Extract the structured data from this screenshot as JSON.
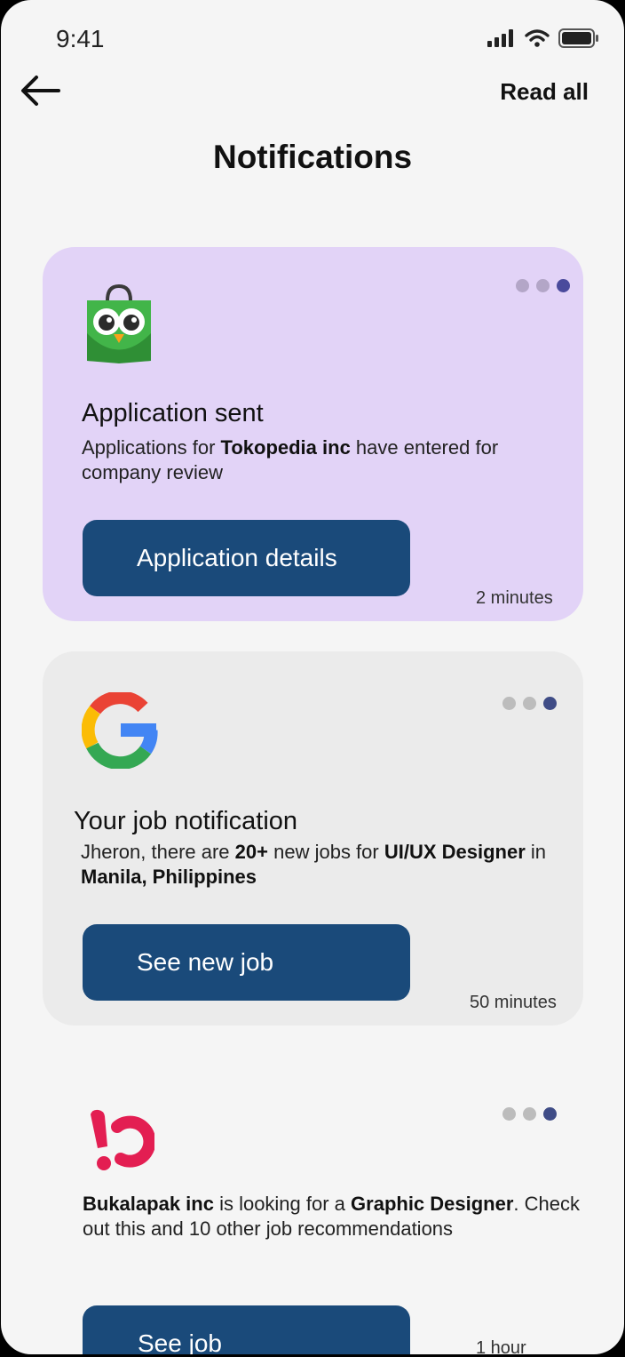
{
  "status_bar": {
    "time": "9:41"
  },
  "header": {
    "read_all_label": "Read all",
    "title": "Notifications"
  },
  "colors": {
    "card_purple": "#e2d3f7",
    "card_grey": "#ebebeb",
    "button": "#1a4a7a",
    "dot_active": "#4a4a9c"
  },
  "notifications": [
    {
      "icon": "tokopedia-owl-icon",
      "title": "Application sent",
      "body": {
        "t1": "Applications for ",
        "b1": "Tokopedia inc",
        "t2": " have entered for company review"
      },
      "button_label": "Application details",
      "time_ago": "2 minutes"
    },
    {
      "icon": "google-g-icon",
      "title": "Your job notification",
      "body": {
        "t1": "Jheron, there are ",
        "b1": "20+",
        "t2": " new jobs for ",
        "b2": "UI/UX Designer",
        "t3": " in ",
        "b3": "Manila, Philippines"
      },
      "button_label": "See new job",
      "time_ago": "50 minutes"
    },
    {
      "icon": "bukalapak-icon",
      "body": {
        "b1": "Bukalapak inc",
        "t1": " is looking for a ",
        "b2": "Graphic Designer",
        "t2": ". Check out this and 10 other job recommendations"
      },
      "button_label": "See job",
      "time_ago": "1 hour"
    }
  ]
}
